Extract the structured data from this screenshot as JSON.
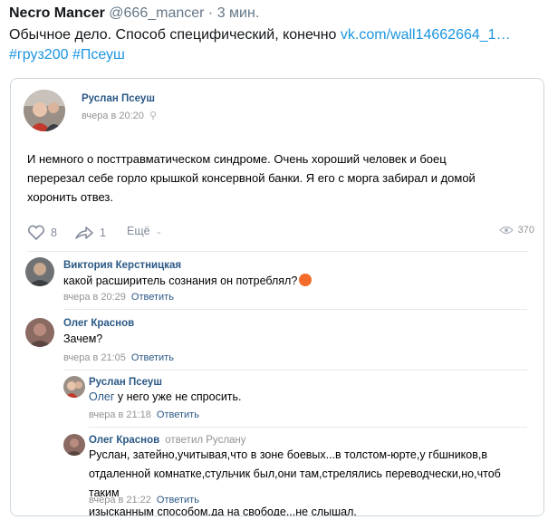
{
  "tweet": {
    "author": "Necro Mancer",
    "handle": "@666_mancer",
    "separator": "·",
    "time": "3 мин.",
    "text": "Обычное дело. Способ специфический, конечно ",
    "link": "vk.com/wall14662664_1…",
    "hashtags": [
      "#груз200",
      "#Псеуш"
    ]
  },
  "post": {
    "author": "Руслан Псеуш",
    "time": "вчера в 20:20",
    "text_lines": [
      "И немного о посттравматическом синдроме. Очень хороший человек и боец",
      "перерезал себе горло крышкой консервной банки. Я его с морга забирал и домой",
      "хоронить отвез."
    ],
    "likes": "8",
    "shares": "1",
    "more_label": "Ещё",
    "views": "370"
  },
  "comments": [
    {
      "author": "Виктория Керстницкая",
      "text": "какой расширитель сознания он потреблял?",
      "time": "вчера в 20:29",
      "reply_label": "Ответить"
    },
    {
      "author": "Олег Краснов",
      "text": "Зачем?",
      "time": "вчера в 21:05",
      "reply_label": "Ответить"
    },
    {
      "author": "Руслан Псеуш",
      "mention": "Олег",
      "text": " у него уже не спросить.",
      "time": "вчера в 21:18",
      "reply_label": "Ответить"
    },
    {
      "author": "Олег Краснов",
      "replied_to": "ответил Руслану",
      "text_lines": [
        "Руслан, затейно,учитывая,что в зоне боевых...в толстом-юрте,у гбшников,в",
        "отдаленной комнатке,стульчик был,они там,стрелялись переводчески,но,чтоб таким",
        "изысканным способом,да на свободе...не слышал."
      ],
      "time": "вчера в 21:22",
      "reply_label": "Ответить"
    }
  ]
}
